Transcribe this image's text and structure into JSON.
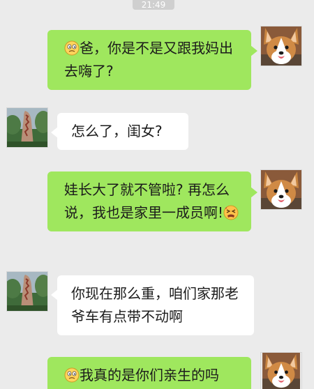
{
  "status": {
    "time": "21:49"
  },
  "messages": [
    {
      "side": "out",
      "avatar": "corgi-avatar",
      "emoji": "confused-face-emoji",
      "text": "爸，你是不是又跟我妈出去嗨了?"
    },
    {
      "side": "in",
      "avatar": "stone-landscape-avatar",
      "text": "怎么了，闺女?"
    },
    {
      "side": "out",
      "avatar": "corgi-avatar",
      "emoji": "tired-face-emoji",
      "text_before": "娃长大了就不管啦? 再怎么说，我也是家里一成员啊!"
    },
    {
      "side": "in",
      "avatar": "stone-landscape-avatar",
      "text": "你现在那么重，咱们家那老爷车有点带不动啊"
    },
    {
      "side": "out",
      "avatar": "corgi-avatar",
      "emoji": "confused-face-emoji",
      "text": "我真的是你们亲生的吗"
    }
  ],
  "colors": {
    "background": "#ebebeb",
    "outgoing_bubble": "#9fe75e",
    "incoming_bubble": "#ffffff"
  }
}
